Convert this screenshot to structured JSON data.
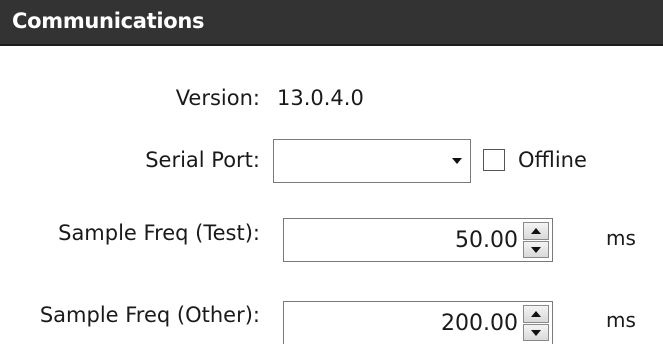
{
  "panel": {
    "title": "Communications",
    "header_color": "#333333"
  },
  "version": {
    "label": "Version:",
    "value": "13.0.4.0"
  },
  "serial_port": {
    "label": "Serial Port:",
    "selected": "",
    "icon": "chevron-down-icon"
  },
  "offline": {
    "label": "Offline",
    "checked": false
  },
  "sample_freq_test": {
    "label": "Sample Freq (Test):",
    "value": "50.00",
    "unit": "ms"
  },
  "sample_freq_other": {
    "label": "Sample Freq (Other):",
    "value": "200.00",
    "unit": "ms"
  }
}
